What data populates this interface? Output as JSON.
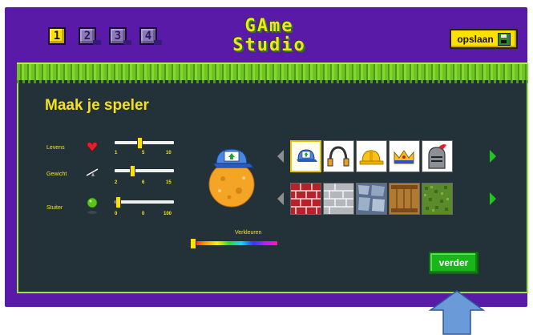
{
  "header": {
    "steps": [
      {
        "label": "1",
        "state": "active"
      },
      {
        "label": "2",
        "state": "inactive"
      },
      {
        "label": "3",
        "state": "inactive"
      },
      {
        "label": "4",
        "state": "inactive"
      }
    ],
    "logo_line1": "GAme",
    "logo_line2": "Studio",
    "save_label": "opslaan",
    "save_icon": "floppy-disk-icon"
  },
  "main": {
    "title": "Maak je speler",
    "sliders": [
      {
        "label": "Levens",
        "icon": "heart-icon",
        "ticks": [
          "1",
          "5",
          "10"
        ],
        "value": 5,
        "min": 1,
        "max": 10
      },
      {
        "label": "Gewicht",
        "icon": "seesaw-icon",
        "ticks": [
          "2",
          "6",
          "15"
        ],
        "value": 6,
        "min": 2,
        "max": 15
      },
      {
        "label": "Stuiter",
        "icon": "bouncing-ball-icon",
        "ticks": [
          "0",
          "0",
          "100"
        ],
        "value": 0,
        "min": 0,
        "max": 100
      }
    ],
    "recolor_label": "Verkleuren",
    "recolor_value": 0,
    "hats": [
      "cap-icon",
      "headphones-icon",
      "hard-hat-icon",
      "crown-icon",
      "knight-helmet-icon"
    ],
    "bodies": [
      "red-brick-icon",
      "gray-brick-icon",
      "stone-icon",
      "wooden-crate-icon",
      "grass-block-icon"
    ],
    "next_label": "verder"
  },
  "colors": {
    "frame": "#5a1aa8",
    "panel": "#233138",
    "accent_yellow": "#ffe100",
    "accent_green": "#1ab51a",
    "pointer_arrow": "#6b9ad8"
  }
}
